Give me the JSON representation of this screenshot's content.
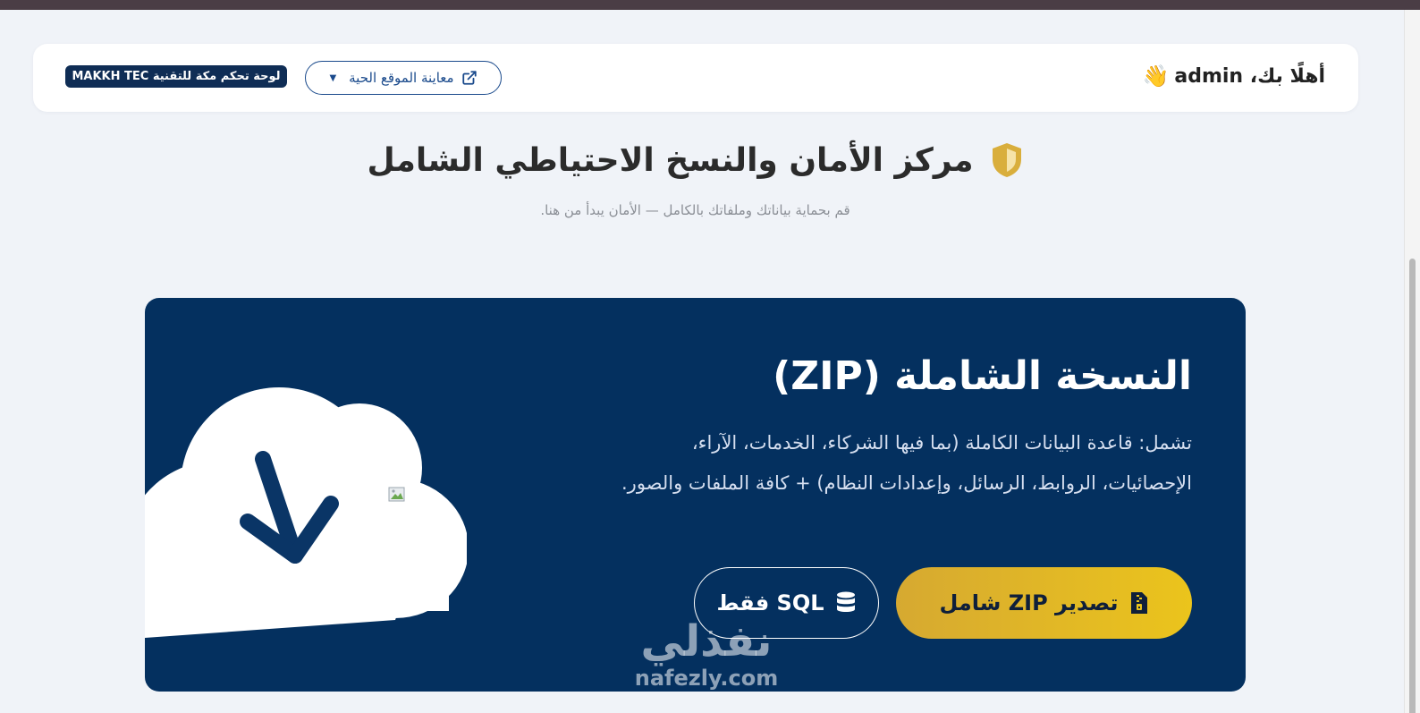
{
  "topbar": {
    "greeting": "أهلًا بك، admin",
    "greeting_emoji": "👋",
    "preview_button": "معاينة الموقع الحية",
    "brand_badge": "لوحة تحكم مكة للتقنية MAKKH TEC"
  },
  "heading": {
    "title": "مركز الأمان والنسخ الاحتياطي الشامل",
    "subtitle": "قم بحماية بياناتك وملفاتك بالكامل — الأمان يبدأ من هنا."
  },
  "backup_card": {
    "title": "النسخة الشاملة (ZIP)",
    "description": "تشمل: قاعدة البيانات الكاملة (بما فيها الشركاء، الخدمات، الآراء، الإحصائيات، الروابط، الرسائل، وإعدادات النظام) + كافة الملفات والصور.",
    "zip_button": "تصدير ZIP شامل",
    "sql_button": "SQL فقط"
  },
  "watermark": {
    "arabic": "نفذلي",
    "latin": "nafezly.com"
  },
  "colors": {
    "card_bg": "#04305f",
    "accent_gold": "#ebc41c",
    "badge_bg": "#0f2d55",
    "shield": "#d9ae3c"
  }
}
